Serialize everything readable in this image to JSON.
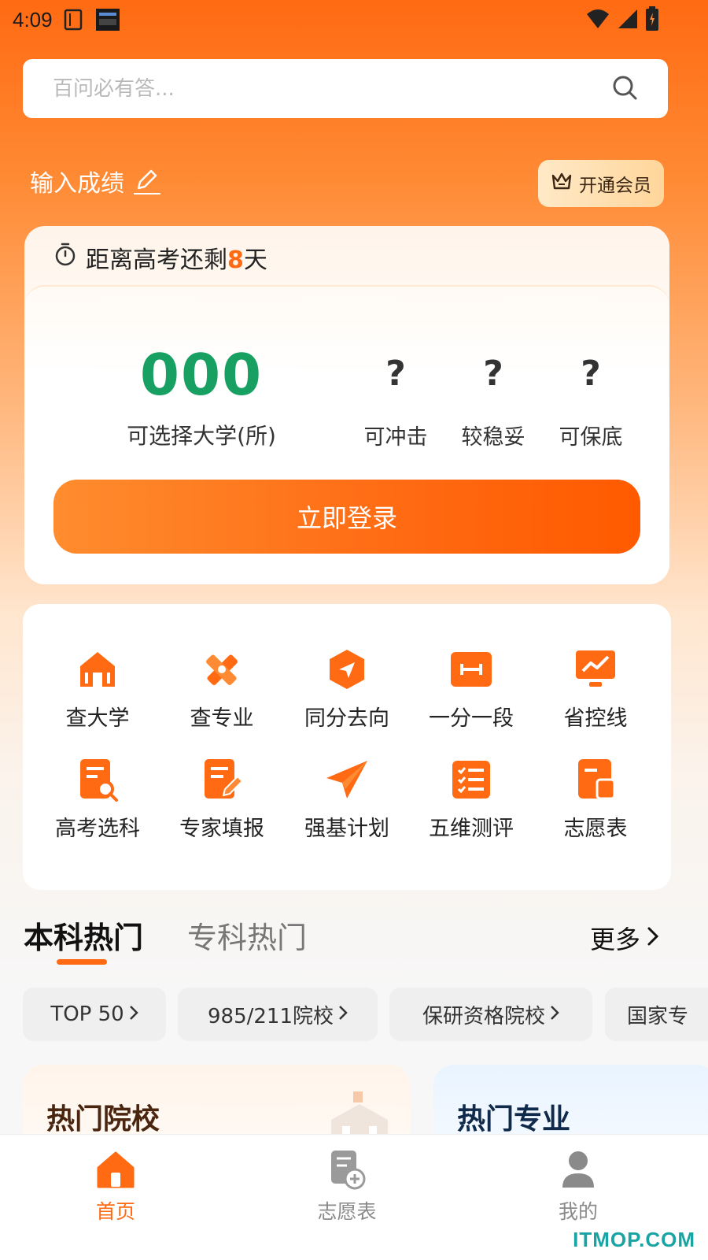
{
  "status": {
    "time": "4:09"
  },
  "search": {
    "placeholder": "百问必有答..."
  },
  "header": {
    "score_label": "输入成绩",
    "vip_label": "开通会员"
  },
  "countdown": {
    "prefix": "距离高考还剩",
    "days": "8",
    "suffix": "天"
  },
  "summary": {
    "count": "000",
    "count_label": "可选择大学(所)",
    "stats": [
      {
        "value": "?",
        "label": "可冲击"
      },
      {
        "value": "?",
        "label": "较稳妥"
      },
      {
        "value": "?",
        "label": "可保底"
      }
    ],
    "login_label": "立即登录"
  },
  "tools": [
    {
      "label": "查大学",
      "icon": "university-icon"
    },
    {
      "label": "查专业",
      "icon": "pencil-ruler-icon"
    },
    {
      "label": "同分去向",
      "icon": "direction-icon"
    },
    {
      "label": "一分一段",
      "icon": "range-icon"
    },
    {
      "label": "省控线",
      "icon": "trend-chart-icon"
    },
    {
      "label": "高考选科",
      "icon": "doc-search-icon"
    },
    {
      "label": "专家填报",
      "icon": "doc-edit-icon"
    },
    {
      "label": "强基计划",
      "icon": "paper-plane-icon"
    },
    {
      "label": "五维测评",
      "icon": "checklist-icon"
    },
    {
      "label": "志愿表",
      "icon": "form-icon"
    }
  ],
  "section": {
    "tab_active": "本科热门",
    "tab_other": "专科热门",
    "more_label": "更多"
  },
  "chips": [
    "TOP 50",
    "985/211院校",
    "保研资格院校",
    "国家专"
  ],
  "hot": {
    "schools_title": "热门院校",
    "majors_title": "热门专业"
  },
  "nav": [
    {
      "label": "首页",
      "icon": "home-icon",
      "active": true
    },
    {
      "label": "志愿表",
      "icon": "form-add-icon",
      "active": false
    },
    {
      "label": "我的",
      "icon": "user-icon",
      "active": false
    }
  ],
  "watermark": "ITMOP.COM",
  "colors": {
    "accent": "#ff6a12",
    "count_green": "#17a061",
    "inactive": "#9a9a9a"
  }
}
